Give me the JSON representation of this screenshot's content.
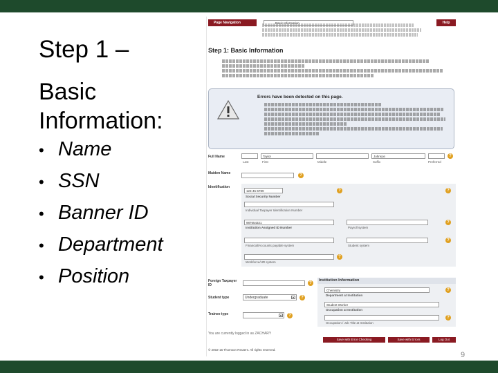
{
  "slide": {
    "title_line1": "Step 1 –",
    "title_line2": "Basic Information:",
    "bullets": [
      "Name",
      "SSN",
      "Banner ID",
      "Department",
      "Position"
    ],
    "bullet_glyph": "•",
    "page_number": "9",
    "bar_color": "#1e4a2c"
  },
  "screenshot": {
    "nav_tab": "Page Navigation",
    "nav_select": "Basic Information",
    "help_button": "Help",
    "step_title": "Step 1: Basic Information",
    "error_title": "Errors have been detected on this page.",
    "form": {
      "full_name_label": "Full Name",
      "full_name_first": "Taylor",
      "full_name_last": "Johnson",
      "name_sub": [
        "Last",
        "First",
        "Middle",
        "Suffix",
        "Preferred"
      ],
      "maiden_name_label": "Maiden Name",
      "identification_label": "Identification",
      "ssn_value": "123-45-6789",
      "ssn_label": "Social Security Number",
      "itin_label": "Individual Taxpayer Identification Number",
      "id_value": "987654321",
      "id_label": "Institution Assigned ID Number",
      "payroll_label": "Payroll system",
      "financial_label": "Financial/Accounts payable system",
      "student_sys_label": "Student system",
      "other_label": "Workforce/HR system",
      "foreign_label": "Foreign Taxpayer ID",
      "student_type_label": "Student type",
      "student_type_value": "Undergraduate",
      "trainee_type_label": "Trainee type",
      "institution_header": "Institution Information",
      "department_value": "Chemistry",
      "department_label": "Department at Institution",
      "occupation_value": "Student Worker",
      "occupation_label": "Occupation at Institution",
      "occupation2_label": "Occupation / Job Title at Institution"
    },
    "logged_in": "You are currently logged in as ZACHARY",
    "buttons": {
      "save_check": "Save with Error Checking",
      "save_errors": "Save with Errors",
      "logout": "Log Out"
    },
    "copyright": "© 2002-15 Thomson Reuters. All rights reserved."
  }
}
